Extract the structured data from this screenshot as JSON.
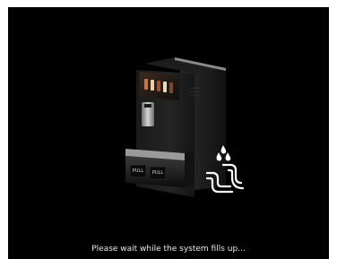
{
  "screen": {
    "status_message": "Please wait while the system fills up...",
    "background_color": "#000000"
  },
  "machine": {
    "pull_labels": [
      "PULL",
      "PULL"
    ]
  },
  "icons": {
    "machine": "coffee-machine-illustration",
    "water_drops": "water-drops-icon",
    "pipe": "water-pipe-icon"
  }
}
